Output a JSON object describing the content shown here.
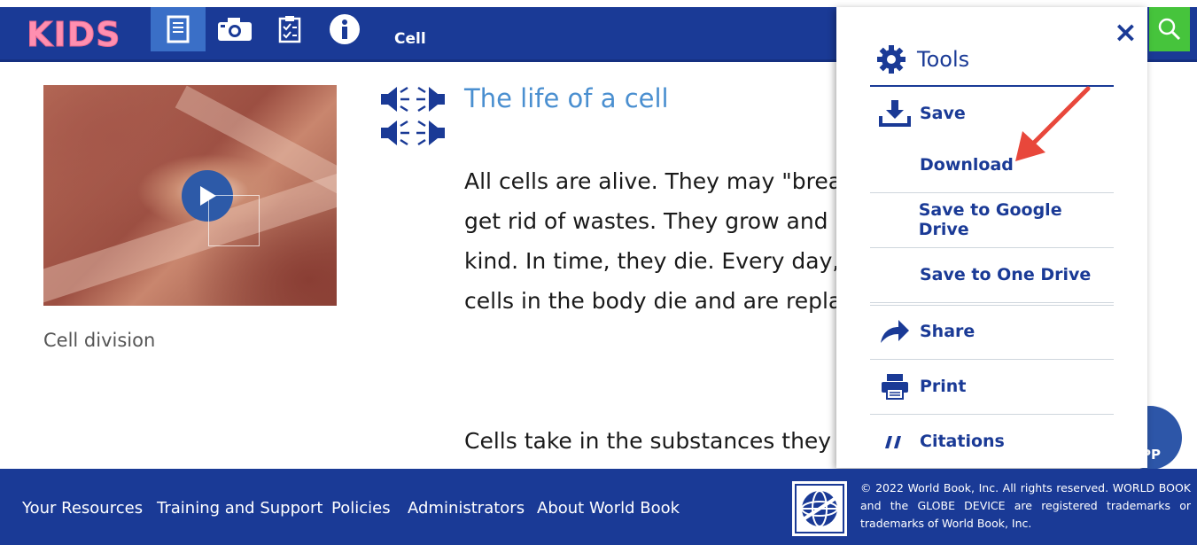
{
  "header": {
    "logo_text": "KIDS",
    "page_name": "Cell",
    "nav_icons": [
      "book-icon",
      "camera-icon",
      "checklist-icon",
      "info-icon"
    ],
    "search_icon": "search-icon",
    "colors": {
      "bar": "#1a3a96",
      "active_tab": "#3a6fc7",
      "search": "#46c43c",
      "logo": "#ff8fb0"
    }
  },
  "media": {
    "caption": "Cell division",
    "play_icon": "play-icon"
  },
  "article": {
    "title": "The life of a cell",
    "audio_icon": "audio-icon",
    "para1": [
      "All cells are alive. They may \"brea",
      "get rid of wastes. They grow and",
      "kind. In time, they die. Every day,",
      "cells in the body die and are repla"
    ],
    "para2": "Cells take in the substances they"
  },
  "tools_panel": {
    "title": "Tools",
    "close_label": "×",
    "items": [
      {
        "label": "Save",
        "icon": "download-icon"
      },
      {
        "label": "Download",
        "icon": ""
      },
      {
        "label": "Save to Google Drive",
        "icon": ""
      },
      {
        "label": "Save to One Drive",
        "icon": ""
      },
      {
        "label": "Share",
        "icon": "share-icon"
      },
      {
        "label": "Print",
        "icon": "printer-icon"
      },
      {
        "label": "Citations",
        "icon": "quote-icon"
      }
    ]
  },
  "fab": {
    "label": "PP"
  },
  "footer": {
    "links": [
      "Your Resources",
      "Training and Support",
      "Policies",
      "Administrators",
      "About World Book"
    ],
    "copyright": "© 2022 World Book, Inc. All rights reserved. WORLD BOOK and the GLOBE DEVICE are registered trademarks or trademarks of World Book, Inc."
  }
}
